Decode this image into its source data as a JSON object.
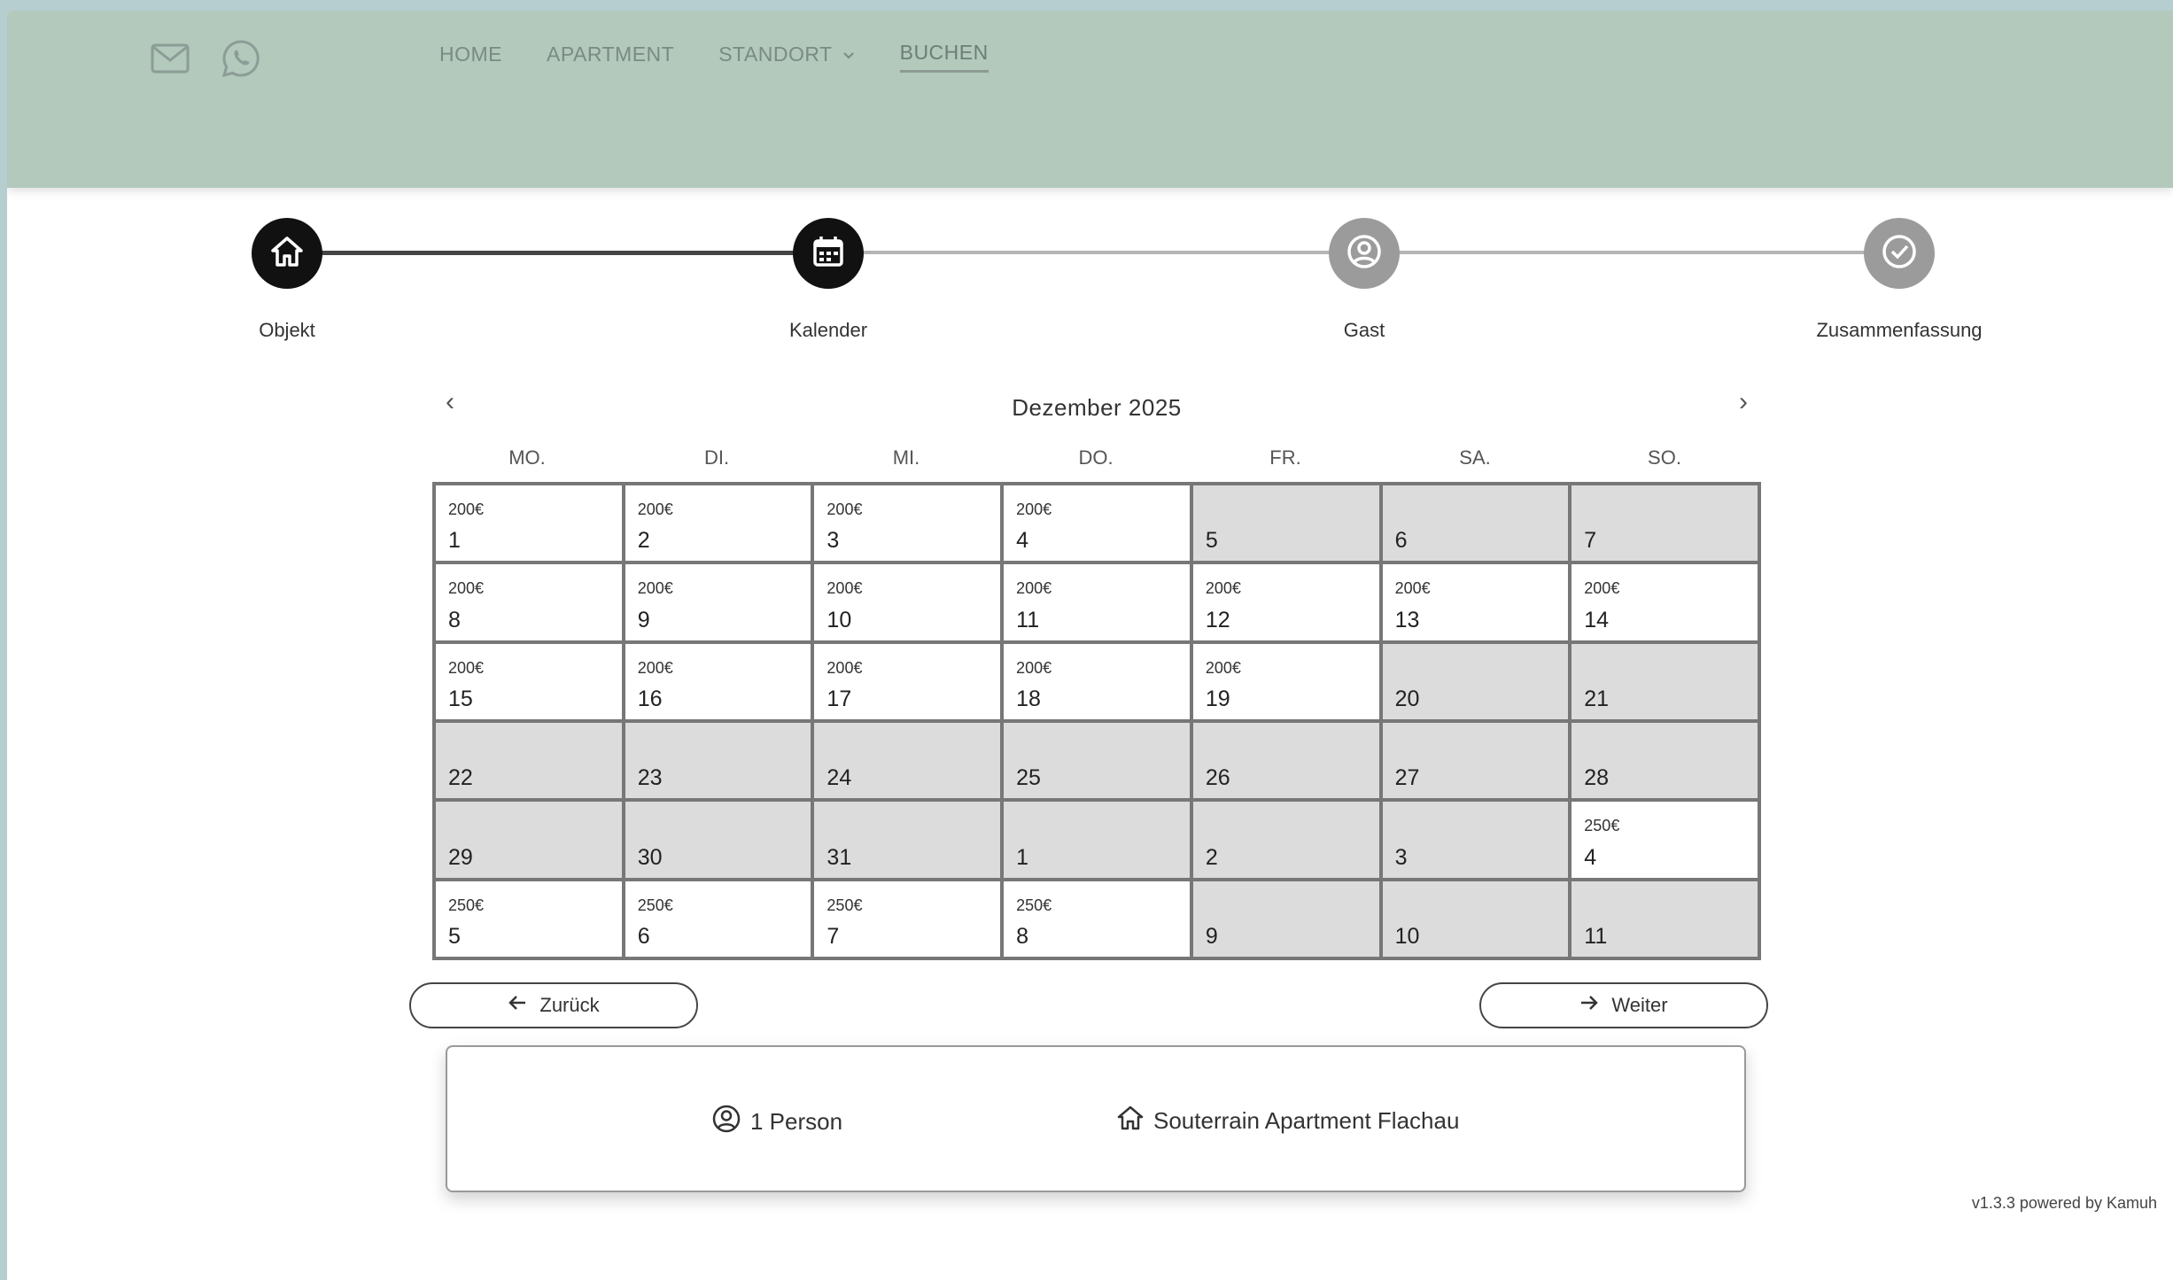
{
  "header": {
    "nav": [
      {
        "label": "HOME"
      },
      {
        "label": "APARTMENT"
      },
      {
        "label": "STANDORT",
        "has_dropdown": true
      },
      {
        "label": "BUCHEN",
        "active": true
      }
    ],
    "contact_icons": [
      "mail-icon",
      "whatsapp-icon"
    ]
  },
  "stepper": {
    "steps": [
      {
        "label": "Objekt",
        "status": "done",
        "icon": "home-icon"
      },
      {
        "label": "Kalender",
        "status": "done",
        "icon": "calendar-icon"
      },
      {
        "label": "Gast",
        "status": "todo",
        "icon": "user-icon"
      },
      {
        "label": "Zusammenfassung",
        "status": "todo",
        "icon": "check-circle-icon"
      }
    ]
  },
  "calendar": {
    "month": "Dezember 2025",
    "prev_label": "‹",
    "next_label": "›",
    "weekdays": [
      "MO.",
      "DI.",
      "MI.",
      "DO.",
      "FR.",
      "SA.",
      "SO."
    ],
    "days": [
      {
        "day": "1",
        "price": "200€",
        "available": true
      },
      {
        "day": "2",
        "price": "200€",
        "available": true
      },
      {
        "day": "3",
        "price": "200€",
        "available": true
      },
      {
        "day": "4",
        "price": "200€",
        "available": true
      },
      {
        "day": "5",
        "price": "",
        "available": false
      },
      {
        "day": "6",
        "price": "",
        "available": false
      },
      {
        "day": "7",
        "price": "",
        "available": false
      },
      {
        "day": "8",
        "price": "200€",
        "available": true
      },
      {
        "day": "9",
        "price": "200€",
        "available": true
      },
      {
        "day": "10",
        "price": "200€",
        "available": true
      },
      {
        "day": "11",
        "price": "200€",
        "available": true
      },
      {
        "day": "12",
        "price": "200€",
        "available": true
      },
      {
        "day": "13",
        "price": "200€",
        "available": true
      },
      {
        "day": "14",
        "price": "200€",
        "available": true
      },
      {
        "day": "15",
        "price": "200€",
        "available": true
      },
      {
        "day": "16",
        "price": "200€",
        "available": true
      },
      {
        "day": "17",
        "price": "200€",
        "available": true
      },
      {
        "day": "18",
        "price": "200€",
        "available": true
      },
      {
        "day": "19",
        "price": "200€",
        "available": true
      },
      {
        "day": "20",
        "price": "",
        "available": false
      },
      {
        "day": "21",
        "price": "",
        "available": false
      },
      {
        "day": "22",
        "price": "",
        "available": false
      },
      {
        "day": "23",
        "price": "",
        "available": false
      },
      {
        "day": "24",
        "price": "",
        "available": false
      },
      {
        "day": "25",
        "price": "",
        "available": false
      },
      {
        "day": "26",
        "price": "",
        "available": false
      },
      {
        "day": "27",
        "price": "",
        "available": false
      },
      {
        "day": "28",
        "price": "",
        "available": false
      },
      {
        "day": "29",
        "price": "",
        "available": false
      },
      {
        "day": "30",
        "price": "",
        "available": false
      },
      {
        "day": "31",
        "price": "",
        "available": false
      },
      {
        "day": "1",
        "price": "",
        "available": false
      },
      {
        "day": "2",
        "price": "",
        "available": false
      },
      {
        "day": "3",
        "price": "",
        "available": false
      },
      {
        "day": "4",
        "price": "250€",
        "available": true
      },
      {
        "day": "5",
        "price": "250€",
        "available": true
      },
      {
        "day": "6",
        "price": "250€",
        "available": true
      },
      {
        "day": "7",
        "price": "250€",
        "available": true
      },
      {
        "day": "8",
        "price": "250€",
        "available": true
      },
      {
        "day": "9",
        "price": "",
        "available": false
      },
      {
        "day": "10",
        "price": "",
        "available": false
      },
      {
        "day": "11",
        "price": "",
        "available": false
      }
    ]
  },
  "buttons": {
    "back_label": "Zurück",
    "next_label": "Weiter"
  },
  "summary": {
    "persons": "1 Person",
    "apartment": "Souterrain Apartment Flachau"
  },
  "footer": {
    "version": "v1.3.3 powered by Kamuh"
  }
}
